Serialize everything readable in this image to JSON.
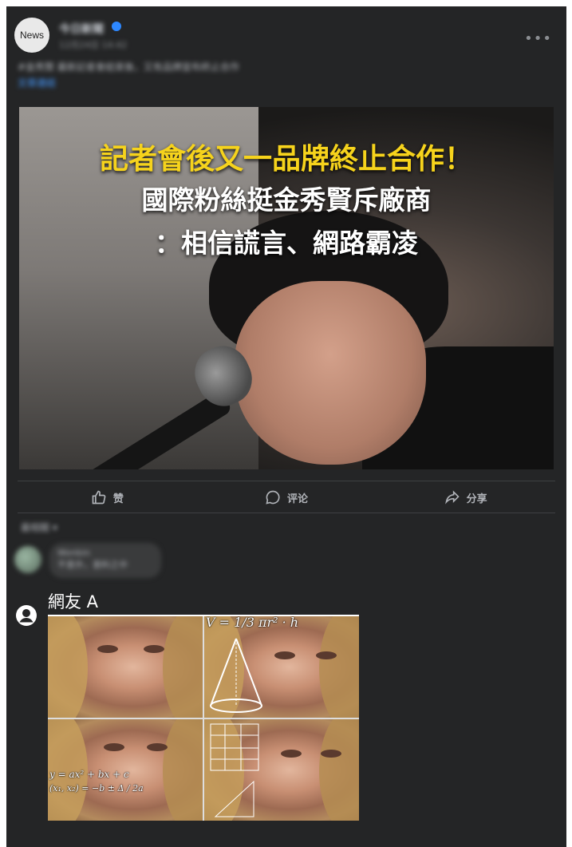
{
  "post": {
    "avatar_label": "News",
    "page_name": "今日新聞",
    "timestamp": "12月24日 14:42",
    "caption": "#金秀賢 最新記者會結束後，又有品牌宣布終止合作",
    "caption_link": "文章連結"
  },
  "image": {
    "headline_line1": "記者會後又一品牌終止合作！",
    "headline_line2": "國際粉絲挺金秀賢斥廠商",
    "headline_line3": "：相信謊言、網路霸凌"
  },
  "actions": {
    "like": "赞",
    "comment": "评论",
    "share": "分享"
  },
  "comments": {
    "sort_label": "最相關",
    "first_comment_name": "Wonbin",
    "first_comment_text": "不意外，意料之中"
  },
  "netizen": {
    "name": "網友 A"
  },
  "meme": {
    "formula_top": "V = 1/3 πr² · h",
    "formula_bottom1": "y = ax² + bx + c",
    "formula_bottom2": "(x₁, x₂) = −b ± Δ / 2a"
  },
  "colors": {
    "panel_bg": "#242526",
    "headline_yellow": "#f6d31c",
    "link_blue": "#4599ff"
  }
}
